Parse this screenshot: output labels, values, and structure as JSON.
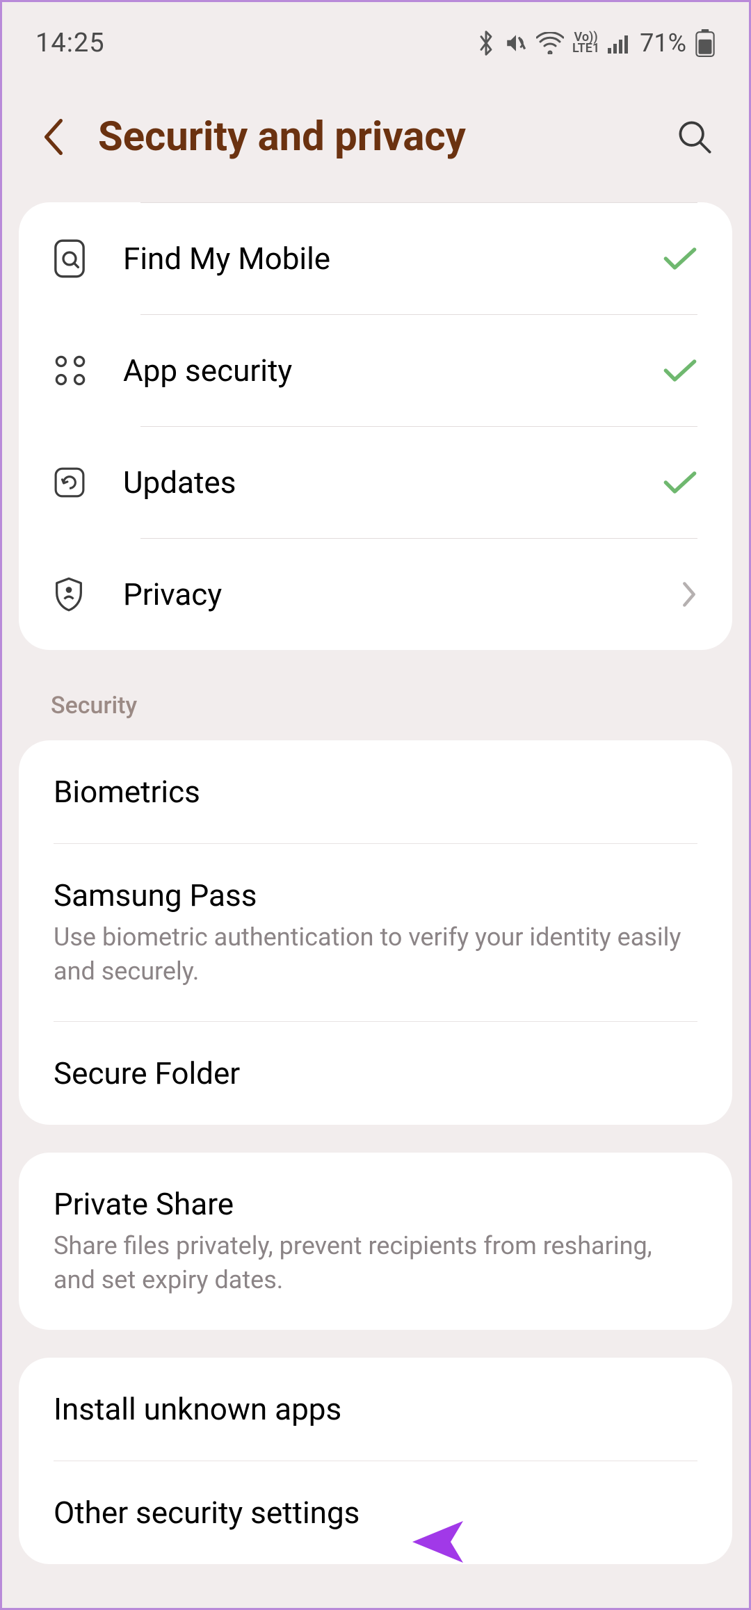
{
  "status": {
    "time": "14:25",
    "battery": "71%"
  },
  "header": {
    "title": "Security and privacy"
  },
  "overview": {
    "items": [
      {
        "label": "Find My Mobile",
        "status": "check"
      },
      {
        "label": "App security",
        "status": "check"
      },
      {
        "label": "Updates",
        "status": "check"
      },
      {
        "label": "Privacy",
        "status": "arrow"
      }
    ]
  },
  "section_label": "Security",
  "group_security": {
    "biometrics": {
      "title": "Biometrics"
    },
    "samsung_pass": {
      "title": "Samsung Pass",
      "desc": "Use biometric authentication to verify your identity easily and securely."
    },
    "secure_folder": {
      "title": "Secure Folder"
    }
  },
  "group_private_share": {
    "title": "Private Share",
    "desc": "Share files privately, prevent recipients from resharing, and set expiry dates."
  },
  "group_other": {
    "install_unknown": {
      "title": "Install unknown apps"
    },
    "other_security": {
      "title": "Other security settings"
    }
  }
}
